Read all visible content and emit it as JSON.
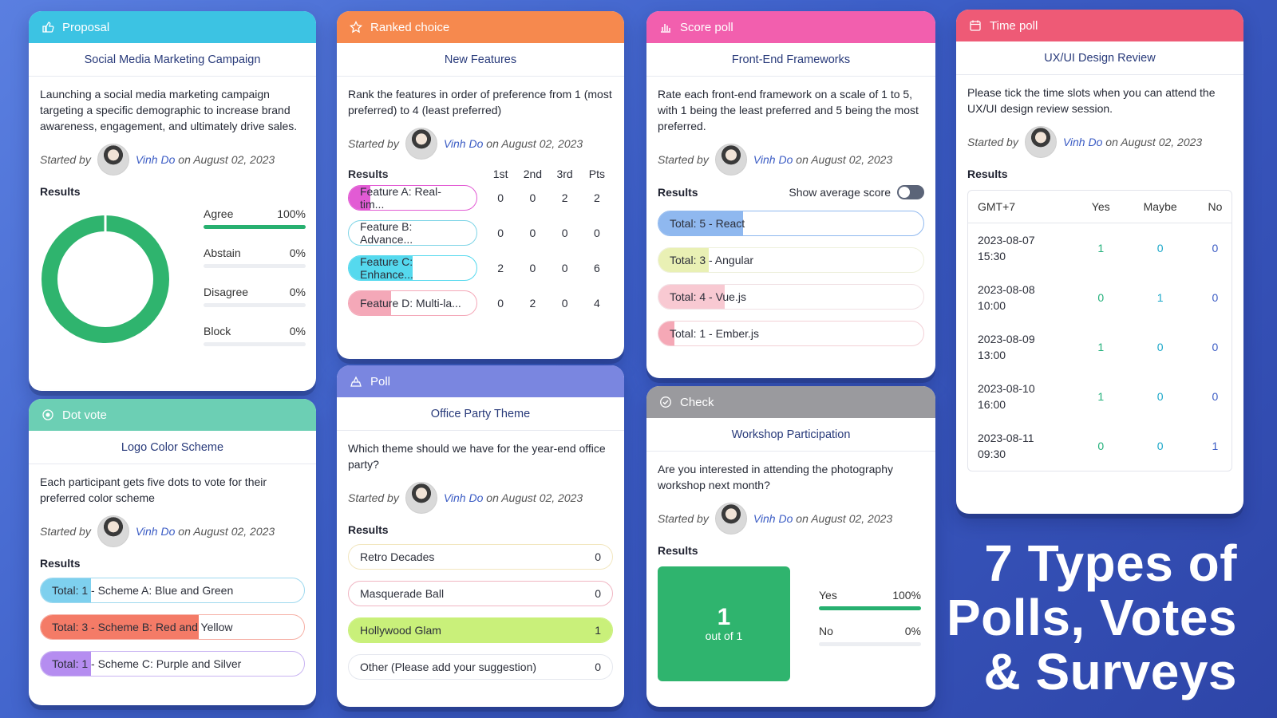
{
  "author": "Vinh Do",
  "started_by": "Started by",
  "date_text": "on August 02, 2023",
  "results_label": "Results",
  "colors": {
    "proposal": "#3cc3e3",
    "ranked": "#f6894e",
    "score": "#f25fae",
    "time": "#ee5a76",
    "dot": "#6ccfb4",
    "poll": "#7a86e0",
    "check": "#9a9a9e",
    "green": "#27b070"
  },
  "proposal": {
    "header": "Proposal",
    "icon": "thumbs-up-icon",
    "title": "Social Media Marketing Campaign",
    "desc": "Launching a social media marketing campaign targeting a specific demographic to increase brand awareness, engagement, and ultimately drive sales.",
    "options": [
      {
        "label": "Agree",
        "pct": "100%",
        "value": 100
      },
      {
        "label": "Abstain",
        "pct": "0%",
        "value": 0
      },
      {
        "label": "Disagree",
        "pct": "0%",
        "value": 0
      },
      {
        "label": "Block",
        "pct": "0%",
        "value": 0
      }
    ]
  },
  "ranked": {
    "header": "Ranked choice",
    "icon": "star-icon",
    "title": "New Features",
    "desc": "Rank the features in order of preference from 1 (most preferred) to 4 (least preferred)",
    "cols": [
      "1st",
      "2nd",
      "3rd",
      "Pts"
    ],
    "rows": [
      {
        "label": "Feature A: Real-tim...",
        "v": [
          "0",
          "0",
          "2",
          "2"
        ],
        "color": "#e25bd4",
        "fill": 0.17
      },
      {
        "label": "Feature B: Advance...",
        "v": [
          "0",
          "0",
          "0",
          "0"
        ],
        "color": "#7ed4e6",
        "fill": 0
      },
      {
        "label": "Feature C: Enhance...",
        "v": [
          "2",
          "0",
          "0",
          "6"
        ],
        "color": "#55d9ee",
        "fill": 0.5
      },
      {
        "label": "Feature D: Multi-la...",
        "v": [
          "0",
          "2",
          "0",
          "4"
        ],
        "color": "#f4a8b8",
        "fill": 0.33
      }
    ]
  },
  "score": {
    "header": "Score poll",
    "icon": "bar-chart-icon",
    "title": "Front-End Frameworks",
    "desc": "Rate each front-end framework on a scale of 1 to 5, with 1 being the least preferred and 5 being the most preferred.",
    "show_avg": "Show average score",
    "rows": [
      {
        "prefix": "Total: 5",
        "label": " - React",
        "fill": 0.32,
        "color": "#8fb8ef",
        "border": "#8fb8ef"
      },
      {
        "prefix": "Total: 3",
        "label": " - Angular",
        "fill": 0.19,
        "color": "#e9f0b4",
        "border": "#eef0dc"
      },
      {
        "prefix": "Total: 4",
        "label": " - Vue.js",
        "fill": 0.25,
        "color": "#f8c9d2",
        "border": "#f0e0e4"
      },
      {
        "prefix": "Total: 1",
        "label": " - Ember.js",
        "fill": 0.06,
        "color": "#f5a8b6",
        "border": "#f3d0d6"
      }
    ]
  },
  "time": {
    "header": "Time poll",
    "icon": "calendar-icon",
    "title": "UX/UI Design Review",
    "desc": "Please tick the time slots when you can attend the UX/UI design review session.",
    "cols": [
      "GMT+7",
      "Yes",
      "Maybe",
      "No"
    ],
    "rows": [
      {
        "d": "2023-08-07",
        "t": "15:30",
        "v": [
          "1",
          "0",
          "0"
        ]
      },
      {
        "d": "2023-08-08",
        "t": "10:00",
        "v": [
          "0",
          "1",
          "0"
        ]
      },
      {
        "d": "2023-08-09",
        "t": "13:00",
        "v": [
          "1",
          "0",
          "0"
        ]
      },
      {
        "d": "2023-08-10",
        "t": "16:00",
        "v": [
          "1",
          "0",
          "0"
        ]
      },
      {
        "d": "2023-08-11",
        "t": "09:30",
        "v": [
          "0",
          "0",
          "1"
        ]
      }
    ]
  },
  "dot": {
    "header": "Dot vote",
    "icon": "target-icon",
    "title": "Logo Color Scheme",
    "desc": "Each participant gets five dots to vote for their preferred color scheme",
    "rows": [
      {
        "prefix": "Total: 1",
        "label": " - Scheme A: Blue and Green",
        "fill": 0.19,
        "color": "#7ed0ee",
        "border": "#9fd9ef"
      },
      {
        "prefix": "Total: 3",
        "label": " - Scheme B: Red and Yellow",
        "fill": 0.6,
        "color": "#f47b67",
        "border": "#f6b0a6"
      },
      {
        "prefix": "Total: 1",
        "label": " - Scheme C: Purple and Silver",
        "fill": 0.19,
        "color": "#b58df0",
        "border": "#c9b4f2"
      }
    ]
  },
  "poll": {
    "header": "Poll",
    "icon": "ballot-icon",
    "title": "Office Party Theme",
    "desc": "Which theme should we have for the year-end office party?",
    "rows": [
      {
        "label": "Retro Decades",
        "val": "0",
        "fill": 0,
        "color": "#f4e7b0",
        "border": "#f2e6bf"
      },
      {
        "label": "Masquerade Ball",
        "val": "0",
        "fill": 0,
        "color": "#f3b7c4",
        "border": "#f0b5c2"
      },
      {
        "label": "Hollywood Glam",
        "val": "1",
        "fill": 1,
        "color": "#c9f07a",
        "border": "#c9f07a"
      },
      {
        "label": "Other (Please add your suggestion)",
        "val": "0",
        "fill": 0,
        "color": "#dde2ea",
        "border": "#e4e7ee"
      }
    ]
  },
  "check": {
    "header": "Check",
    "icon": "check-circle-icon",
    "title": "Workshop Participation",
    "desc": "Are you interested in attending the photography workshop next month?",
    "count": "1",
    "out_of": "out of 1",
    "options": [
      {
        "label": "Yes",
        "pct": "100%",
        "value": 100
      },
      {
        "label": "No",
        "pct": "0%",
        "value": 0
      }
    ]
  },
  "hero": {
    "line1": "7 Types of",
    "line2": "Polls, Votes",
    "line3": "& Surveys"
  }
}
